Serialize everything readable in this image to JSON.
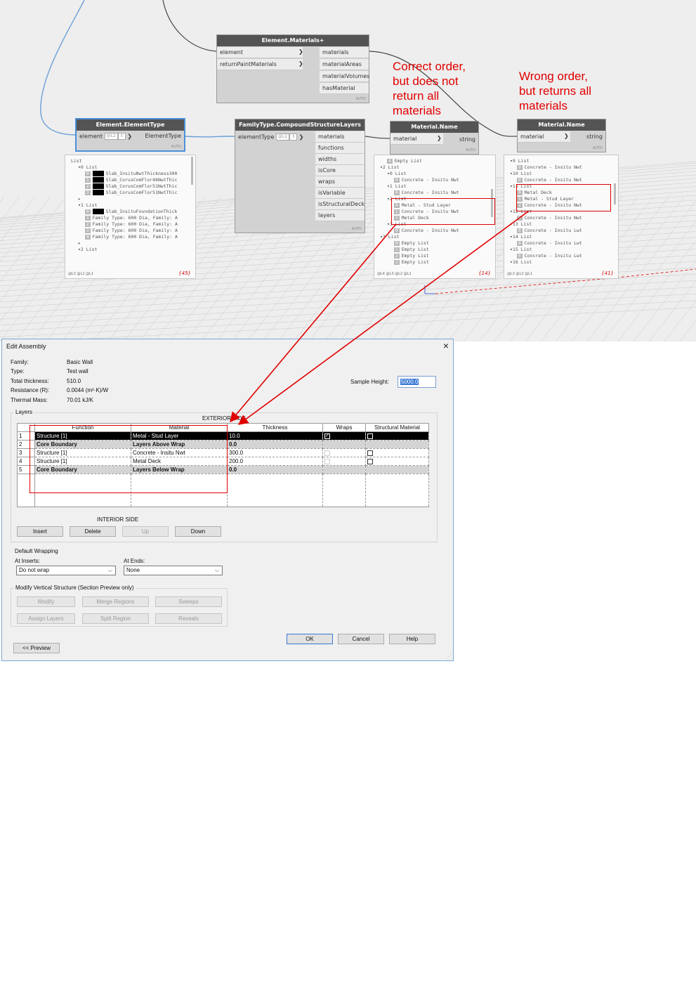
{
  "nodes": {
    "materials_plus": {
      "title": "Element.Materials+",
      "inputs": [
        "element",
        "returnPaintMaterials"
      ],
      "outputs": [
        "materials",
        "materialAreas",
        "materialVolumes",
        "hasMaterial"
      ],
      "auto": "AUTO"
    },
    "element_type": {
      "title": "Element.ElementType",
      "input": "element",
      "lacing": "@L2",
      "output": "ElementType",
      "auto": "AUTO"
    },
    "compound_layers": {
      "title": "FamilyType.CompoundStructureLayers",
      "input": "elementType",
      "lacing": "@L2",
      "outputs": [
        "materials",
        "functions",
        "widths",
        "isCore",
        "wraps",
        "isVariable",
        "isStructuralDeck",
        "layers"
      ],
      "auto": "AUTO"
    },
    "material_name_1": {
      "title": "Material.Name",
      "input": "material",
      "output": "string",
      "auto": "AUTO"
    },
    "material_name_2": {
      "title": "Material.Name",
      "input": "material",
      "output": "string",
      "auto": "AUTO"
    }
  },
  "watch_1": {
    "lines": [
      {
        "indent": 0,
        "text": "List"
      },
      {
        "indent": 1,
        "text": "▾0 List"
      },
      {
        "indent": 2,
        "idx": "0",
        "block": true,
        "text": "Slab_InsituNwtThickness300"
      },
      {
        "indent": 2,
        "idx": "1",
        "block": true,
        "text": "Slab_CorusComFlor46NwtThic"
      },
      {
        "indent": 2,
        "idx": "2",
        "block": true,
        "text": "Slab_CorusComFlor51NwtThic"
      },
      {
        "indent": 2,
        "idx": "3",
        "block": true,
        "text": "Slab_CorusComFlor51NwtThic"
      },
      {
        "indent": 1,
        "text": "▸"
      },
      {
        "indent": 1,
        "text": "▾1 List"
      },
      {
        "indent": 2,
        "idx": "0",
        "block": true,
        "text": "Slab_InsituFoundationThick"
      },
      {
        "indent": 2,
        "idx": "1",
        "text": "Family Type: 600 Dia, Family: A"
      },
      {
        "indent": 2,
        "idx": "2",
        "text": "Family Type: 600 Dia, Family: A"
      },
      {
        "indent": 2,
        "idx": "3",
        "text": "Family Type: 600 Dia, Family: A"
      },
      {
        "indent": 2,
        "idx": "4",
        "text": "Family Type: 600 Dia, Family: A"
      },
      {
        "indent": 1,
        "text": "▸"
      },
      {
        "indent": 1,
        "text": "▾2 List"
      }
    ],
    "footer": "@L3 @L2 @L1",
    "count": "{45}"
  },
  "watch_2": {
    "lines": [
      {
        "indent": 1,
        "idx": "4",
        "text": "Empty List"
      },
      {
        "indent": 0,
        "text": "▾2 List"
      },
      {
        "indent": 1,
        "text": "▾0 List"
      },
      {
        "indent": 2,
        "idx": "0",
        "text": "Concrete - Insitu Nwt"
      },
      {
        "indent": 1,
        "text": "▾1 List"
      },
      {
        "indent": 2,
        "idx": "0",
        "text": "Concrete - Insitu Nwt"
      },
      {
        "indent": 1,
        "text": "▾2 List"
      },
      {
        "indent": 2,
        "idx": "0",
        "text": "Metal - Stud Layer"
      },
      {
        "indent": 2,
        "idx": "1",
        "text": "Concrete - Insitu Nwt"
      },
      {
        "indent": 2,
        "idx": "2",
        "text": "Metal Deck"
      },
      {
        "indent": 1,
        "text": "▾3 List"
      },
      {
        "indent": 2,
        "idx": "0",
        "text": "Concrete - Insitu Nwt"
      },
      {
        "indent": 0,
        "text": "▾3 List"
      },
      {
        "indent": 2,
        "idx": "0",
        "text": "Empty List"
      },
      {
        "indent": 2,
        "idx": "1",
        "text": "Empty List"
      },
      {
        "indent": 2,
        "idx": "2",
        "text": "Empty List"
      },
      {
        "indent": 2,
        "idx": "3",
        "text": "Empty List"
      }
    ],
    "footer": "@L4 @L3 @L2 @L1",
    "count": "{14}"
  },
  "watch_3": {
    "lines": [
      {
        "indent": 0,
        "text": "▾9 List"
      },
      {
        "indent": 1,
        "idx": "0",
        "text": "Concrete - Insitu Nwt"
      },
      {
        "indent": 0,
        "text": "▾10 List"
      },
      {
        "indent": 1,
        "idx": "0",
        "text": "Concrete - Insitu Nwt"
      },
      {
        "indent": 0,
        "text": "▾11 List"
      },
      {
        "indent": 1,
        "idx": "0",
        "text": "Metal Deck"
      },
      {
        "indent": 1,
        "idx": "1",
        "text": "Metal - Stud Layer"
      },
      {
        "indent": 1,
        "idx": "2",
        "text": "Concrete - Insitu Nwt"
      },
      {
        "indent": 0,
        "text": "▾12 List"
      },
      {
        "indent": 1,
        "idx": "0",
        "text": "Concrete - Insitu Nwt"
      },
      {
        "indent": 0,
        "text": "▾13 List"
      },
      {
        "indent": 1,
        "idx": "0",
        "text": "Concrete - Insitu Lwt"
      },
      {
        "indent": 0,
        "text": "▾14 List"
      },
      {
        "indent": 1,
        "idx": "0",
        "text": "Concrete - Insitu Lwt"
      },
      {
        "indent": 0,
        "text": "▾15 List"
      },
      {
        "indent": 1,
        "idx": "0",
        "text": "Concrete - Insitu Lwt"
      },
      {
        "indent": 0,
        "text": "▾16 List"
      }
    ],
    "footer": "@L3 @L2 @L1",
    "count": "{41}"
  },
  "annotations": {
    "correct": [
      "Correct order,",
      "but does not",
      "return all",
      "materials"
    ],
    "wrong": [
      "Wrong order,",
      "but returns all",
      "materials"
    ]
  },
  "dialog": {
    "title": "Edit Assembly",
    "close": "×",
    "info": [
      {
        "label": "Family:",
        "value": "Basic Wall"
      },
      {
        "label": "Type:",
        "value": "Test wall"
      },
      {
        "label": "Total thickness:",
        "value": "510.0"
      },
      {
        "label": "Resistance (R):",
        "value": "0.0044 (m²·K)/W"
      },
      {
        "label": "Thermal Mass:",
        "value": "70.01 kJ/K"
      }
    ],
    "sample_height_label": "Sample Height:",
    "sample_height_value": "5000.0",
    "layers_label": "Layers",
    "exterior_side": "EXTERIOR SIDE",
    "interior_side": "INTERIOR SIDE",
    "columns": [
      "",
      "Function",
      "Material",
      "Thickness",
      "Wraps",
      "Structural Material"
    ],
    "rows": [
      {
        "n": "1",
        "function": "Structure [1]",
        "material": "Metal - Stud Layer",
        "thickness": "10.0"
      },
      {
        "n": "2",
        "function": "Core Boundary",
        "material": "Layers Above Wrap",
        "thickness": "0.0"
      },
      {
        "n": "3",
        "function": "Structure [1]",
        "material": "Concrete - Insitu Nwt",
        "thickness": "300.0"
      },
      {
        "n": "4",
        "function": "Structure [1]",
        "material": "Metal Deck",
        "thickness": "200.0"
      },
      {
        "n": "5",
        "function": "Core Boundary",
        "material": "Layers Below Wrap",
        "thickness": "0.0"
      }
    ],
    "buttons": {
      "insert": "Insert",
      "delete": "Delete",
      "up": "Up",
      "down": "Down"
    },
    "default_wrapping": "Default Wrapping",
    "at_inserts_label": "At Inserts:",
    "at_inserts_value": "Do not wrap",
    "at_ends_label": "At Ends:",
    "at_ends_value": "None",
    "modify_vertical": "Modify Vertical Structure (Section Preview only)",
    "mod_buttons": {
      "modify": "Modify",
      "merge": "Merge Regions",
      "sweeps": "Sweeps",
      "assign": "Assign Layers",
      "split": "Split Region",
      "reveals": "Reveals"
    },
    "ok": "OK",
    "cancel": "Cancel",
    "help": "Help",
    "preview": "<< Preview"
  },
  "colors": {
    "annotation_red": "#e10000",
    "node_header": "#545454",
    "selection_blue": "#4a90d9"
  }
}
